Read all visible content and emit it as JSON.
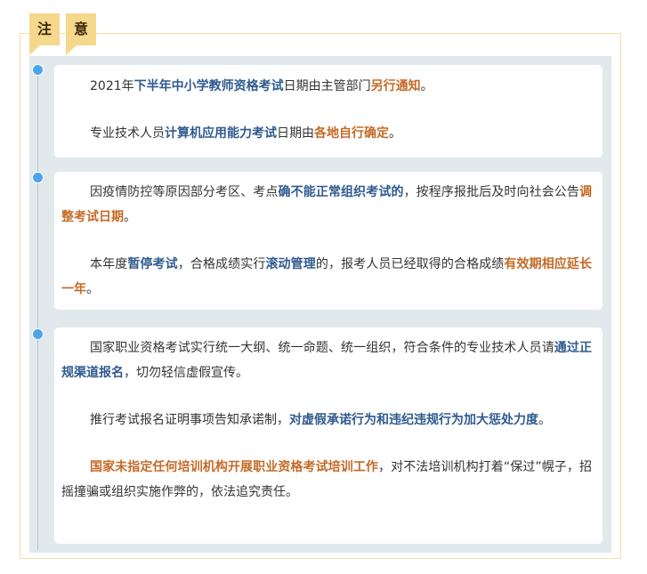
{
  "header": {
    "tag_1": "注",
    "tag_2": "意"
  },
  "section_1": {
    "p1": {
      "a": "2021年",
      "b": "下半年中小学教师资格考试",
      "c": "日期由主管部门",
      "d": "另行通知",
      "e": "。"
    },
    "p2": {
      "a": "专业技术人员",
      "b": "计算机应用能力考试",
      "c": "日期由",
      "d": "各地自行确定",
      "e": "。"
    }
  },
  "section_2": {
    "p1": {
      "a": "因疫情防控等原因部分考区、考点",
      "b": "确不能正常组织考试的",
      "c": "，按程序报批后及时向社会公告",
      "d": "调整考试日期",
      "e": "。"
    },
    "p2": {
      "a": "本年度",
      "b": "暂停考试",
      "c": "，合格成绩实行",
      "d": "滚动管理",
      "e": "的，报考人员已经取得的合格成绩",
      "f": "有效期相应延长一年",
      "g": "。"
    }
  },
  "section_3": {
    "p1": {
      "a": "国家职业资格考试实行统一大纲、统一命题、统一组织，符合条件的专业技术人员请",
      "b": "通过正规渠道报名",
      "c": "，切勿轻信虚假宣传。"
    },
    "p2": {
      "a": "推行考试报名证明事项告知承诺制，",
      "b": "对虚假承诺行为和违纪违规行为加大惩处力度",
      "c": "。"
    },
    "p3": {
      "a": "国家未指定任何培训机构开展职业资格考试培训工作",
      "b": "，对不法培训机构打着“保过”幌子，招摇撞骗或组织实施作弊的，依法追究责任。"
    }
  },
  "colors": {
    "blue_emphasis": "#2f5b8f",
    "orange_emphasis": "#c46a27",
    "tag_bg": "#f6d88c",
    "dot": "#4da3ea"
  }
}
